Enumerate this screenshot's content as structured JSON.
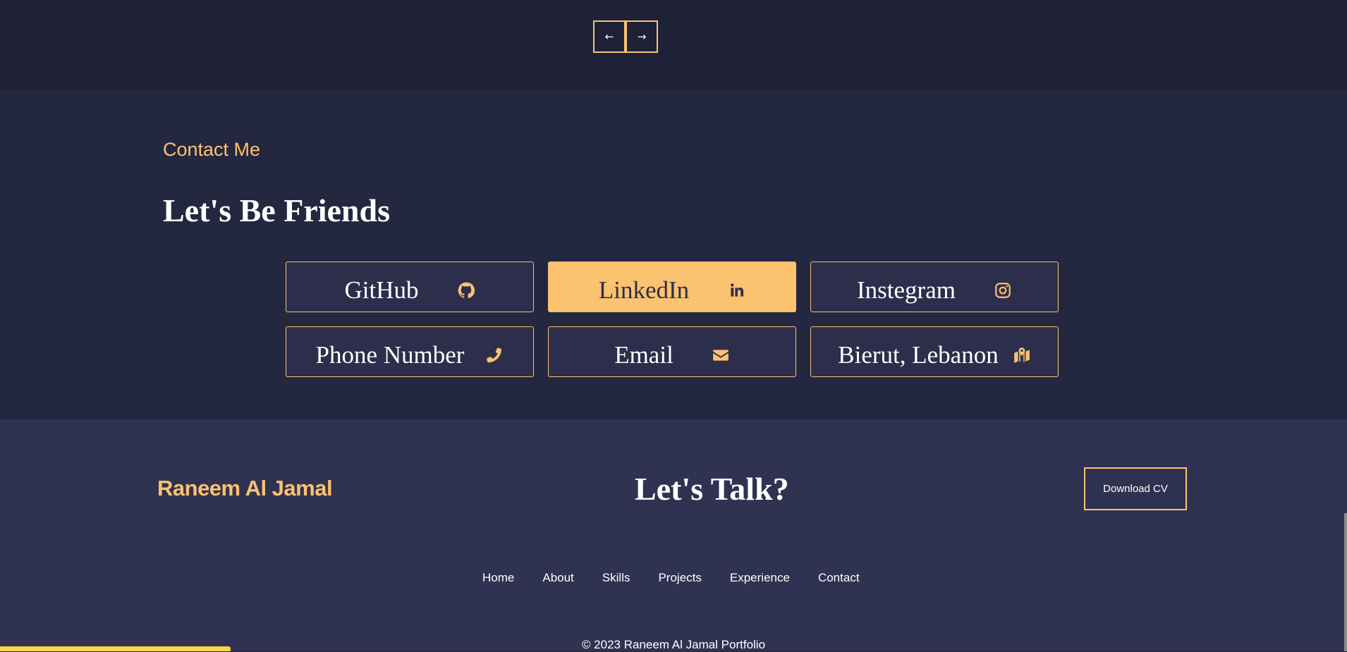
{
  "carousel": {
    "prev_label": "←",
    "next_label": "→"
  },
  "contact": {
    "kicker": "Contact Me",
    "title": "Let's Be Friends",
    "cards": [
      {
        "label": "GitHub",
        "icon": "github-icon",
        "active": false
      },
      {
        "label": "LinkedIn",
        "icon": "linkedin-icon",
        "active": true
      },
      {
        "label": "Instegram",
        "icon": "instagram-icon",
        "active": false
      },
      {
        "label": "Phone Number",
        "icon": "phone-icon",
        "active": false
      },
      {
        "label": "Email",
        "icon": "envelope-icon",
        "active": false
      },
      {
        "label": "Bierut, Lebanon",
        "icon": "map-location-icon",
        "active": false
      }
    ]
  },
  "footer": {
    "brand": "Raneem Al Jamal",
    "cta": "Let's Talk?",
    "cv_button": "Download CV",
    "nav": [
      "Home",
      "About",
      "Skills",
      "Projects",
      "Experience",
      "Contact"
    ],
    "copyright": "© 2023 Raneem Al Jamal Portfolio"
  },
  "colors": {
    "accent": "#fbc26f",
    "background": "#242740",
    "footer_background": "#303252",
    "card_background": "#2c2e4c"
  }
}
